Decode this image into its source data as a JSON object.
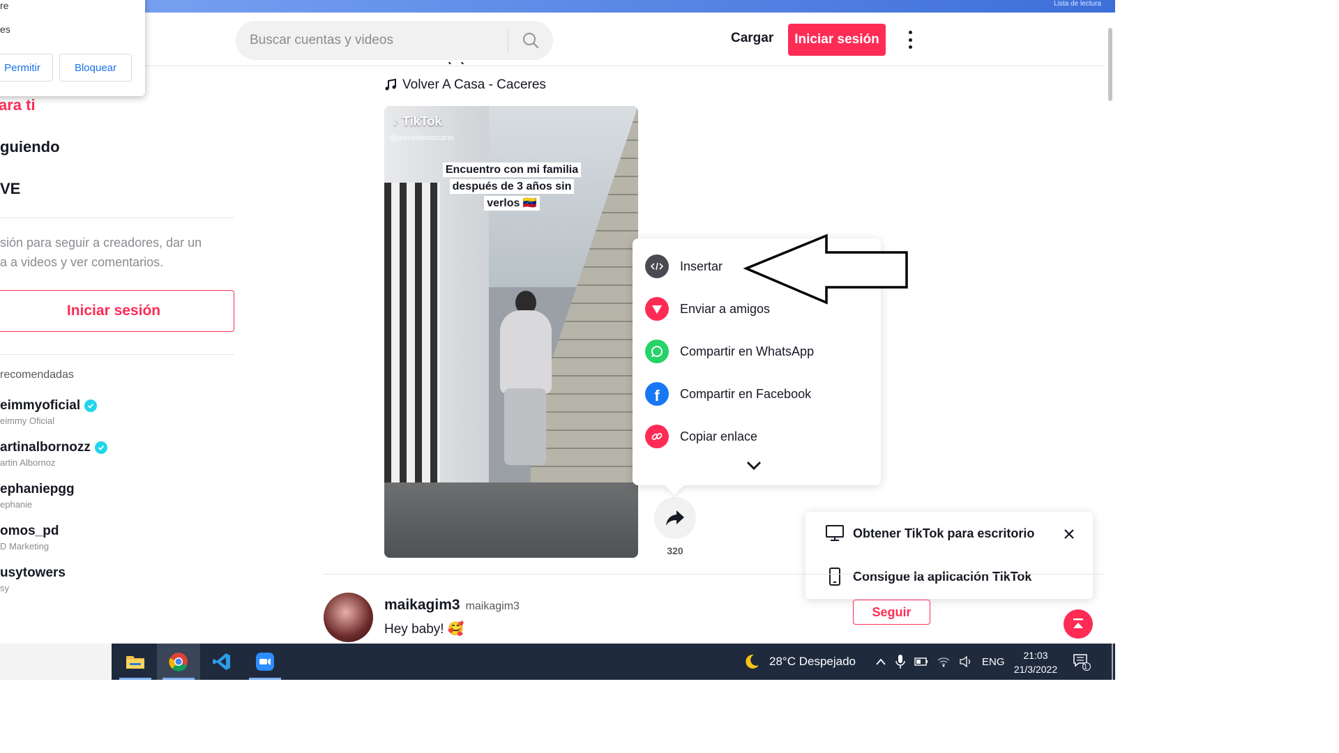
{
  "browser": {
    "reading_list": "Lista de lectura"
  },
  "header": {
    "search_placeholder": "Buscar cuentas y videos",
    "upload_label": "Cargar",
    "login_label": "Iniciar sesión"
  },
  "permission_popup": {
    "line1": "re",
    "line2": "es",
    "allow": "Permitir",
    "block": "Bloquear"
  },
  "sidebar": {
    "nav": [
      "ara ti",
      "guiendo",
      "VE"
    ],
    "login_prompt_line1": "sión para seguir a creadores, dar un",
    "login_prompt_line2": "a a videos y ver comentarios.",
    "login_button": "Iniciar sesión",
    "recommended_title": "recomendadas",
    "accounts": [
      {
        "username": "eimmyoficial",
        "name": "eimmy Oficial",
        "verified": true
      },
      {
        "username": "artinalbornozz",
        "name": "artin Albornoz",
        "verified": true
      },
      {
        "username": "ephaniepgg",
        "name": "ephanie",
        "verified": false
      },
      {
        "username": "omos_pd",
        "name": "D Marketing",
        "verified": false
      },
      {
        "username": "usytowers",
        "name": "sy",
        "verified": false
      }
    ]
  },
  "post": {
    "music": "Volver A Casa - Caceres",
    "watermark": "TikTok",
    "watermark_handle": "@jesusdemarcano",
    "caption_line1": "Encuentro con mi familia",
    "caption_line2": "después de 3 años sin",
    "caption_line3": "verlos 🇻🇪",
    "share_count": "320"
  },
  "share_menu": {
    "items": [
      {
        "label": "Insertar",
        "icon": "embed-icon",
        "color": "#4a4b52"
      },
      {
        "label": "Enviar a amigos",
        "icon": "send-icon",
        "color": "#fe2c55"
      },
      {
        "label": "Compartir en WhatsApp",
        "icon": "whatsapp-icon",
        "color": "#25d366"
      },
      {
        "label": "Compartir en Facebook",
        "icon": "facebook-icon",
        "color": "#1877f2"
      },
      {
        "label": "Copiar enlace",
        "icon": "link-icon",
        "color": "#fe2c55"
      }
    ]
  },
  "promo": {
    "desktop": "Obtener TikTok para escritorio",
    "app": "Consigue la aplicación TikTok"
  },
  "next_post": {
    "username": "maikagim3",
    "nickname": "maikagim3",
    "description": "Hey baby! 🥰",
    "follow": "Seguir"
  },
  "taskbar": {
    "weather": "28°C  Despejado",
    "language": "ENG",
    "time": "21:03",
    "date": "21/3/2022",
    "notification_count": "1"
  },
  "colors": {
    "accent": "#fe2c55",
    "taskbar": "#1f2a3d"
  }
}
